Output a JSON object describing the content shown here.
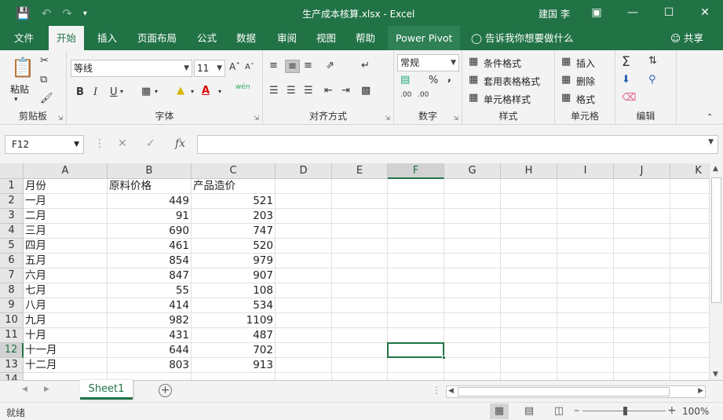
{
  "titlebar": {
    "title": "生产成本核算.xlsx  -  Excel",
    "user": "建国 李",
    "icons": [
      "save-icon",
      "undo-icon",
      "redo-icon",
      "customize-qat-icon"
    ]
  },
  "tabs": [
    {
      "label": "文件"
    },
    {
      "label": "开始",
      "active": true
    },
    {
      "label": "插入"
    },
    {
      "label": "页面布局"
    },
    {
      "label": "公式"
    },
    {
      "label": "数据"
    },
    {
      "label": "审阅"
    },
    {
      "label": "视图"
    },
    {
      "label": "帮助"
    },
    {
      "label": "Power Pivot"
    }
  ],
  "tell_me": "告诉我你想要做什么",
  "share": "共享",
  "ribbon": {
    "clipboard": {
      "label": "剪贴板",
      "paste": "粘贴"
    },
    "font": {
      "label": "字体",
      "font_name": "等线",
      "font_size": "11",
      "bold": "B",
      "italic": "I",
      "underline": "U",
      "wen": "wén"
    },
    "alignment": {
      "label": "对齐方式"
    },
    "number": {
      "label": "数字",
      "format": "常规",
      "percent": "%",
      "comma": ","
    },
    "styles": {
      "label": "样式",
      "conditional": "条件格式",
      "table": "套用表格格式",
      "cell_styles": "单元格样式"
    },
    "cells": {
      "label": "单元格",
      "insert": "插入",
      "delete": "删除",
      "format": "格式"
    },
    "editing": {
      "label": "编辑"
    }
  },
  "formula_bar": {
    "name_box": "F12",
    "fx": "fx",
    "formula": ""
  },
  "columns": [
    "A",
    "B",
    "C",
    "D",
    "E",
    "F",
    "G",
    "H",
    "I",
    "J",
    "K"
  ],
  "selected_column": "F",
  "selected_row": "12",
  "rows": [
    {
      "n": "1",
      "a": "月份",
      "b": "原料价格",
      "c": "产品造价"
    },
    {
      "n": "2",
      "a": "一月",
      "b": "449",
      "c": "521"
    },
    {
      "n": "3",
      "a": "二月",
      "b": "91",
      "c": "203"
    },
    {
      "n": "4",
      "a": "三月",
      "b": "690",
      "c": "747"
    },
    {
      "n": "5",
      "a": "四月",
      "b": "461",
      "c": "520"
    },
    {
      "n": "6",
      "a": "五月",
      "b": "854",
      "c": "979"
    },
    {
      "n": "7",
      "a": "六月",
      "b": "847",
      "c": "907"
    },
    {
      "n": "8",
      "a": "七月",
      "b": "55",
      "c": "108"
    },
    {
      "n": "9",
      "a": "八月",
      "b": "414",
      "c": "534"
    },
    {
      "n": "10",
      "a": "九月",
      "b": "982",
      "c": "1109"
    },
    {
      "n": "11",
      "a": "十月",
      "b": "431",
      "c": "487"
    },
    {
      "n": "12",
      "a": "十一月",
      "b": "644",
      "c": "702"
    },
    {
      "n": "13",
      "a": "十二月",
      "b": "803",
      "c": "913"
    },
    {
      "n": "14",
      "a": "",
      "b": "",
      "c": ""
    }
  ],
  "sheet_tab": "Sheet1",
  "status": {
    "ready": "就绪",
    "zoom": "100%"
  },
  "colors": {
    "accent": "#217346",
    "ribbon_bg": "#f3f3f3"
  }
}
